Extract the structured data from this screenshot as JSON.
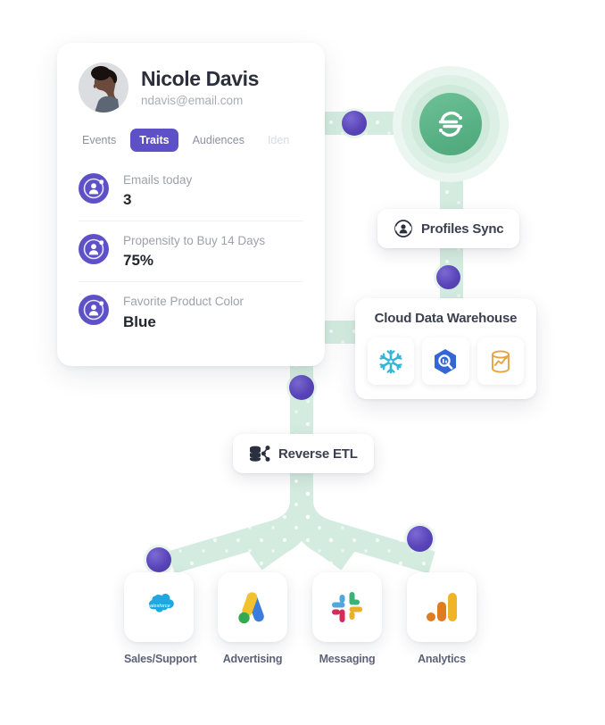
{
  "profile": {
    "name": "Nicole Davis",
    "email": "ndavis@email.com",
    "avatar_icon": "user-avatar-illustration",
    "tabs": [
      {
        "label": "Events",
        "active": false,
        "faded": false
      },
      {
        "label": "Traits",
        "active": true,
        "faded": false
      },
      {
        "label": "Audiences",
        "active": false,
        "faded": false
      },
      {
        "label": "Iden",
        "active": false,
        "faded": true
      }
    ],
    "traits": [
      {
        "icon": "profile-trait-icon",
        "label": "Emails today",
        "value": "3"
      },
      {
        "icon": "profile-trait-icon",
        "label": "Propensity to Buy 14 Days",
        "value": "75%"
      },
      {
        "icon": "profile-trait-icon",
        "label": "Favorite Product Color",
        "value": "Blue"
      }
    ]
  },
  "segment_node": {
    "icon": "segment-logo-icon"
  },
  "profiles_sync": {
    "icon": "profiles-sync-icon",
    "label": "Profiles Sync"
  },
  "reverse_etl": {
    "icon": "reverse-etl-icon",
    "label": "Reverse ETL"
  },
  "warehouse": {
    "title": "Cloud Data Warehouse",
    "icons": [
      {
        "name": "snowflake-icon"
      },
      {
        "name": "google-bigquery-icon"
      },
      {
        "name": "amazon-redshift-icon"
      }
    ]
  },
  "destinations": [
    {
      "icon": "salesforce-icon",
      "label": "Sales/Support"
    },
    {
      "icon": "google-ads-icon",
      "label": "Advertising"
    },
    {
      "icon": "slack-icon",
      "label": "Messaging"
    },
    {
      "icon": "analytics-icon",
      "label": "Analytics"
    }
  ],
  "colors": {
    "accent_purple": "#5e51c8",
    "dot_purple": "#5a45b8",
    "pipe_green": "#d4ece0",
    "segment_green": "#58b184",
    "label_slate": "#5c6378"
  }
}
